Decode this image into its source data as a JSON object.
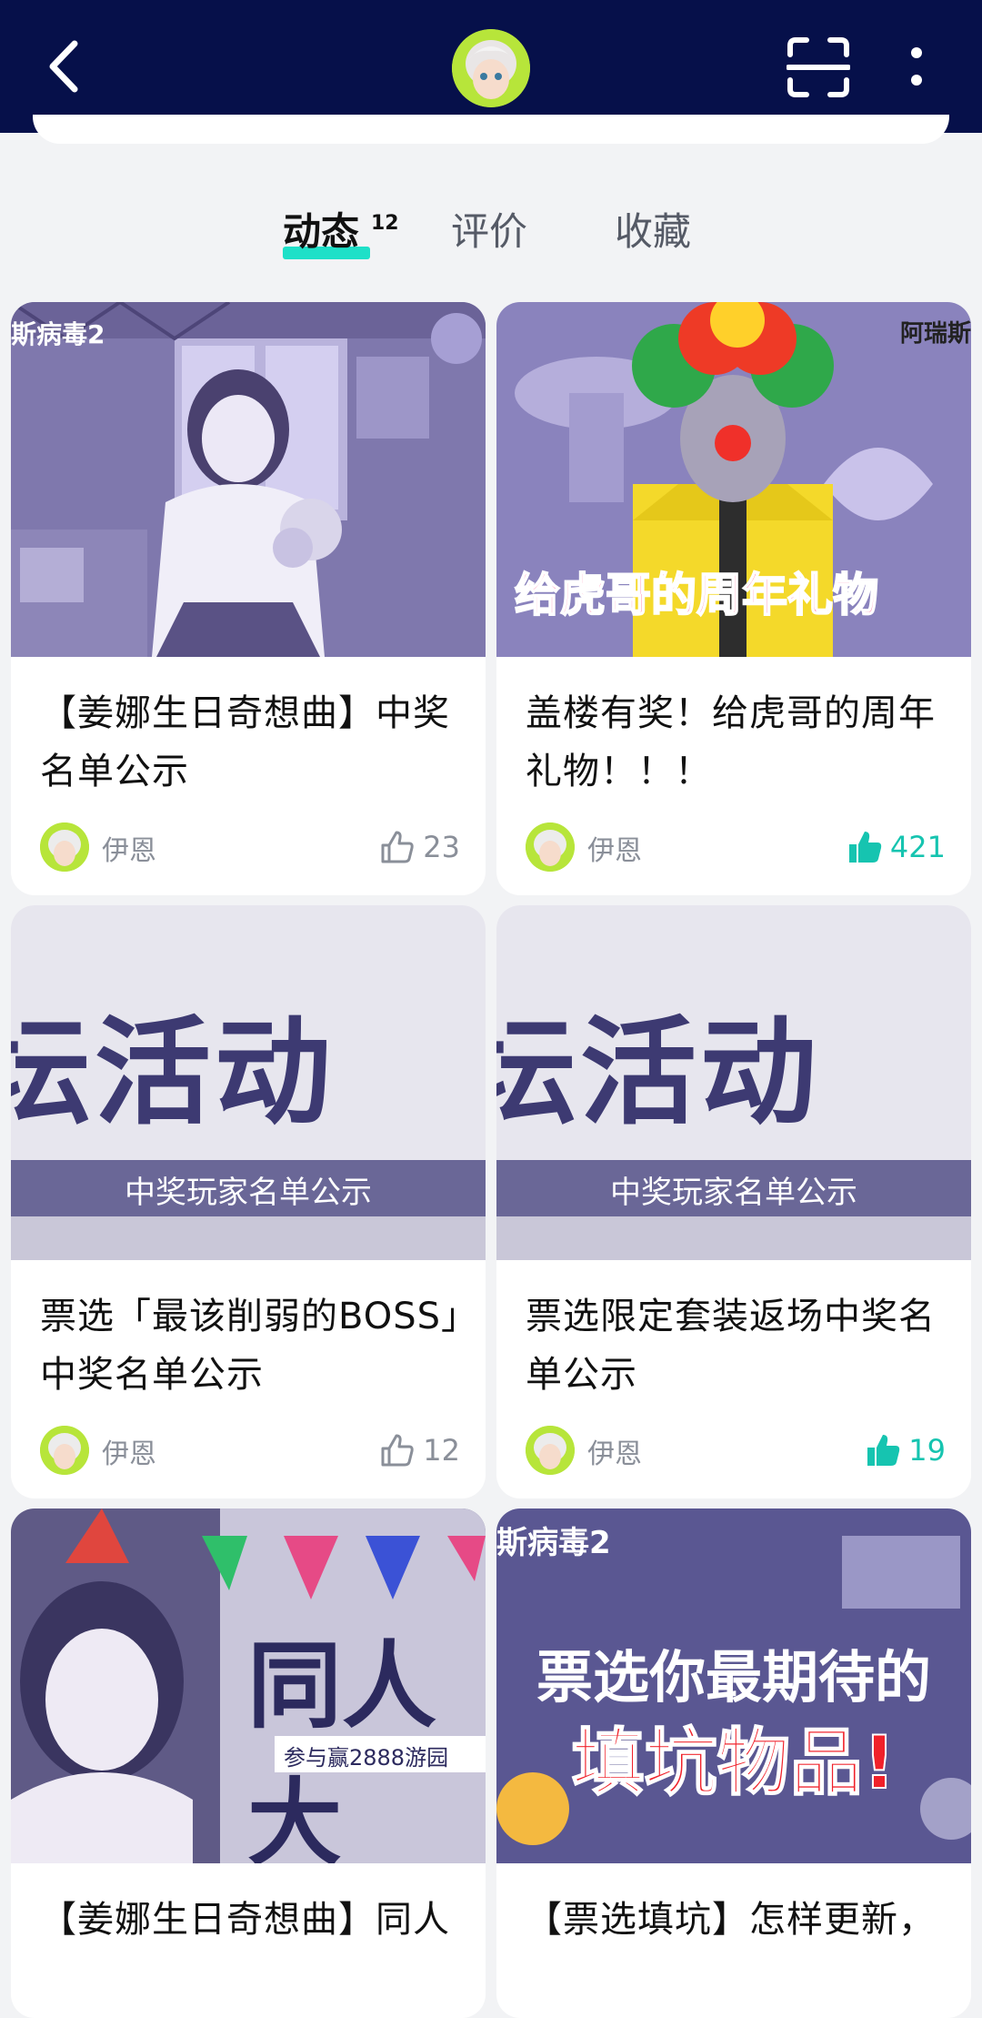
{
  "header": {
    "back_icon": "chevron-left-icon",
    "scan_icon": "scan-icon",
    "more_icon": "more-vertical-icon",
    "background": "#06104a"
  },
  "tabs": [
    {
      "label": "动态",
      "count": "12",
      "active": true
    },
    {
      "label": "评价",
      "active": false
    },
    {
      "label": "收藏",
      "active": false
    }
  ],
  "posts": [
    {
      "image_caption": "斯病毒2",
      "title": "【姜娜生日奇想曲】中奖名单公示",
      "author": "伊恩",
      "likes": "23",
      "liked": false
    },
    {
      "image_caption": "给虎哥的周年礼物",
      "image_corner": "阿瑞斯",
      "title": "盖楼有奖！给虎哥的周年礼物！！！",
      "author": "伊恩",
      "likes": "421",
      "liked": true
    },
    {
      "image_caption": "坛活动",
      "image_subcaption": "中奖玩家名单公示",
      "title": "票选「最该削弱的BOSS」中奖名单公示",
      "author": "伊恩",
      "likes": "12",
      "liked": false
    },
    {
      "image_caption": "坛活动",
      "image_subcaption": "中奖玩家名单公示",
      "title": "票选限定套装返场中奖名单公示",
      "author": "伊恩",
      "likes": "19",
      "liked": true
    },
    {
      "image_caption": "同人大",
      "image_subcaption": "参与赢2888游园",
      "title": "【姜娜生日奇想曲】同人",
      "author": "伊恩"
    },
    {
      "image_caption": "票选你最期待的",
      "image_caption2": "填坑物品!",
      "image_corner": "斯病毒2",
      "title": "【票选填坑】怎样更新，",
      "author": "伊恩"
    }
  ],
  "colors": {
    "accent": "#1ee0c8",
    "like_active": "#16c4b0",
    "muted": "#8a8f99"
  }
}
